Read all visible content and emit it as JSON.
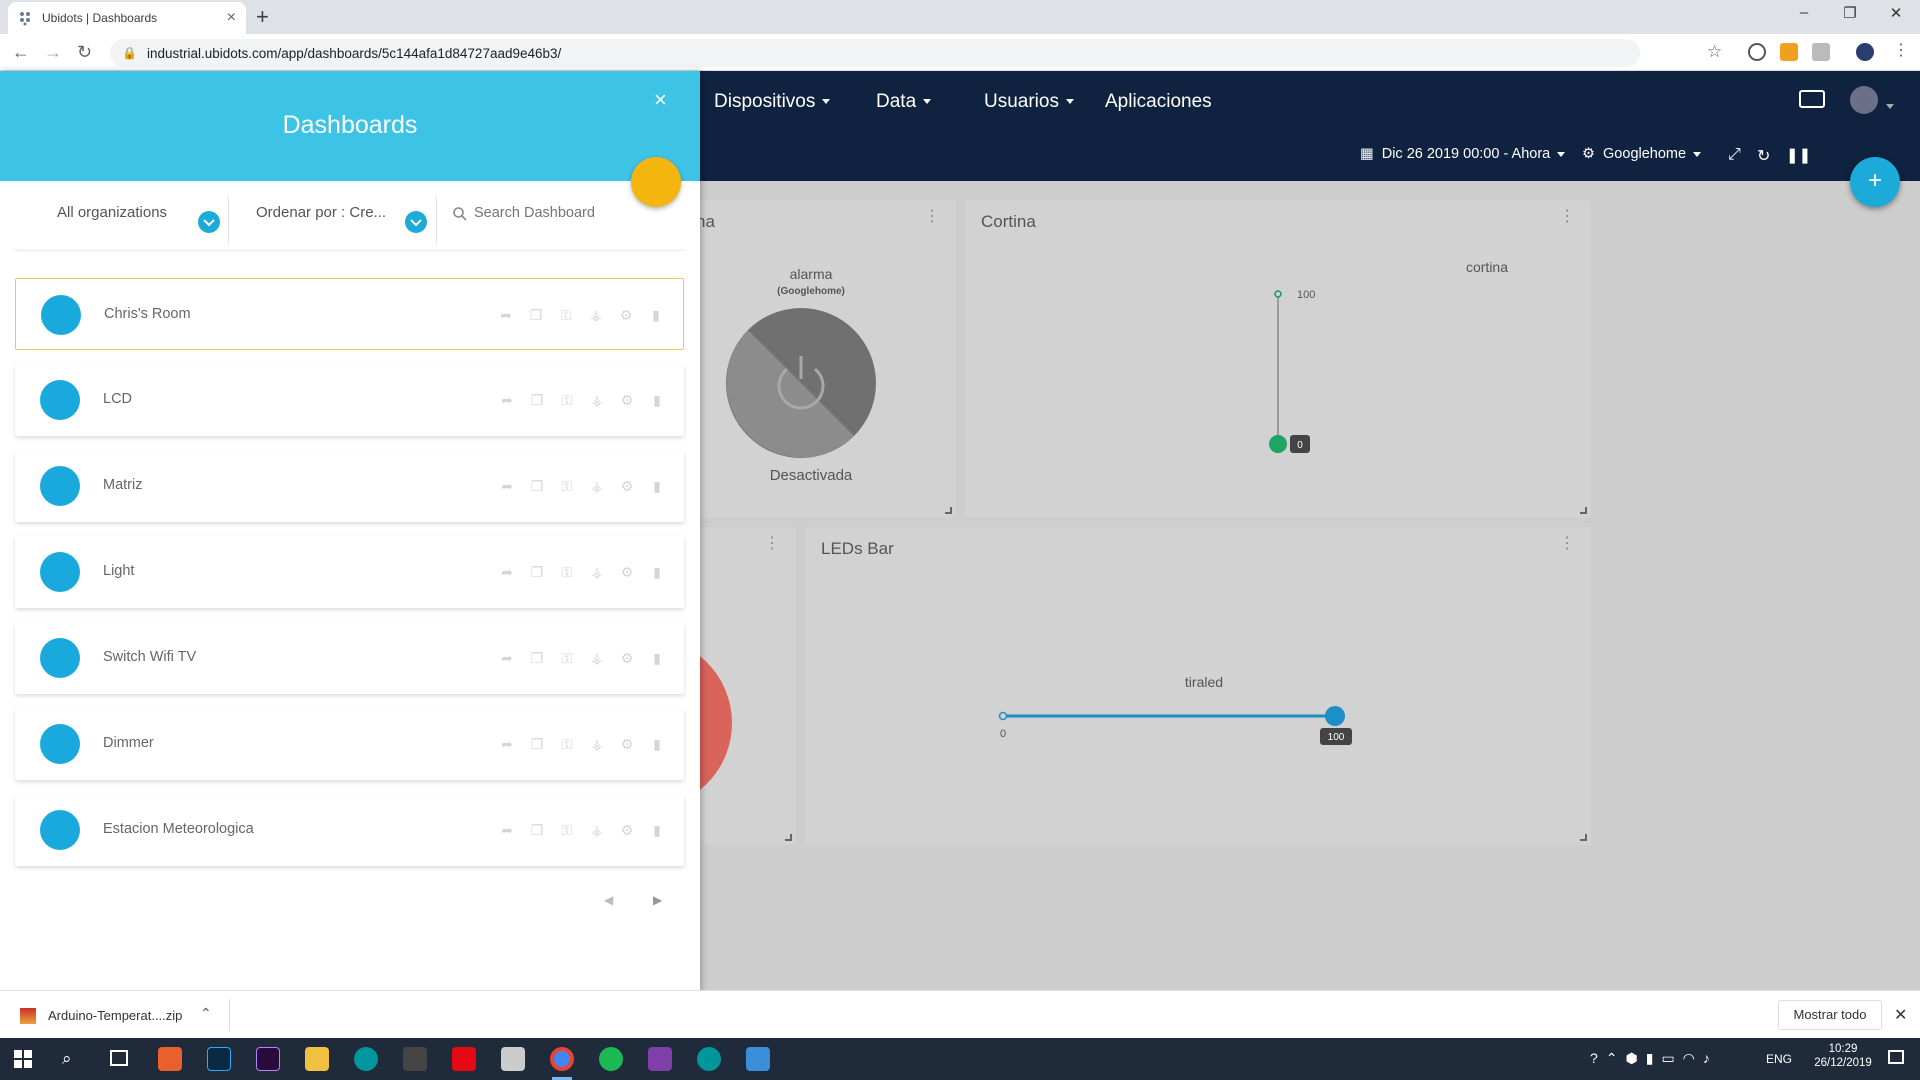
{
  "browser": {
    "tab_title": "Ubidots | Dashboards",
    "url": "industrial.ubidots.com/app/dashboards/5c144afa1d84727aad9e46b3/"
  },
  "nav": {
    "items": [
      {
        "label": "Dispositivos",
        "has_caret": true
      },
      {
        "label": "Data",
        "has_caret": true
      },
      {
        "label": "Usuarios",
        "has_caret": true
      },
      {
        "label": "Aplicaciones",
        "has_caret": false
      }
    ]
  },
  "toolbar": {
    "date_range": "Dic 26 2019 00:00 - Ahora",
    "device": "Googlehome"
  },
  "widgets": {
    "alarm": {
      "title_partial": "na",
      "var_name": "alarma",
      "device": "(Googlehome)",
      "state": "Desactivada"
    },
    "cortina": {
      "title": "Cortina",
      "var_name": "cortina",
      "max_label": "100",
      "value_label": "0",
      "value": 0
    },
    "leds": {
      "title": "LEDs Bar",
      "var_name": "tiraled",
      "min_label": "0",
      "value_label": "100",
      "value": 100
    }
  },
  "panel": {
    "title": "Dashboards",
    "org_filter": "All organizations",
    "sort_filter": "Ordenar por : Cre...",
    "search_placeholder": "Search Dashboard",
    "dashboards": [
      {
        "name": "Chris's Room"
      },
      {
        "name": "LCD"
      },
      {
        "name": "Matriz"
      },
      {
        "name": "Light"
      },
      {
        "name": "Switch Wifi TV"
      },
      {
        "name": "Dimmer"
      },
      {
        "name": "Estacion Meteorologica"
      }
    ]
  },
  "download": {
    "file": "Arduino-Temperat....zip",
    "show_all": "Mostrar todo"
  },
  "taskbar": {
    "lang": "ENG",
    "time": "10:29",
    "date": "26/12/2019"
  },
  "colors": {
    "accent": "#1caad9",
    "panel_header": "#3dc3e6",
    "header_bg": "#0f2240",
    "fab_yellow": "#f5b50f"
  }
}
